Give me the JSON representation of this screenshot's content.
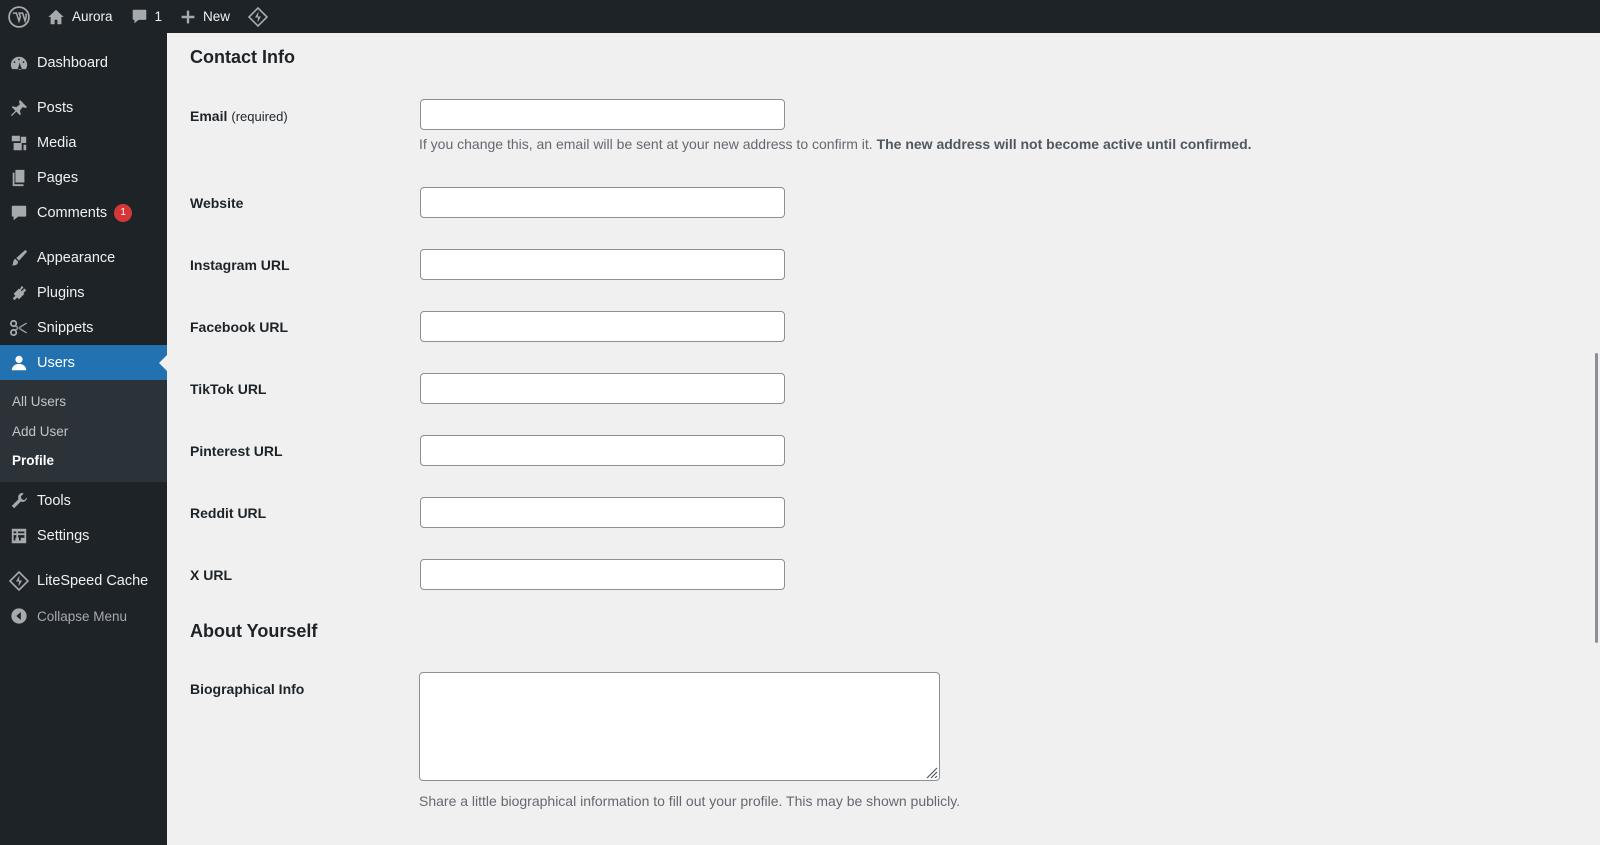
{
  "admin_bar": {
    "site_name": "Aurora",
    "comments_count": "1",
    "new_label": "New"
  },
  "sidebar": {
    "items": [
      {
        "label": "Dashboard",
        "icon": "dashboard-icon"
      },
      {
        "label": "Posts",
        "icon": "pin-icon"
      },
      {
        "label": "Media",
        "icon": "media-icon"
      },
      {
        "label": "Pages",
        "icon": "pages-icon"
      },
      {
        "label": "Comments",
        "icon": "comment-icon",
        "badge": "1"
      },
      {
        "label": "Appearance",
        "icon": "brush-icon"
      },
      {
        "label": "Plugins",
        "icon": "plugin-icon"
      },
      {
        "label": "Snippets",
        "icon": "scissors-icon"
      },
      {
        "label": "Users",
        "icon": "user-icon",
        "current": true
      },
      {
        "label": "Tools",
        "icon": "wrench-icon"
      },
      {
        "label": "Settings",
        "icon": "settings-icon"
      },
      {
        "label": "LiteSpeed Cache",
        "icon": "litespeed-icon"
      },
      {
        "label": "Collapse Menu",
        "icon": "collapse-icon"
      }
    ],
    "users_submenu": [
      {
        "label": "All Users"
      },
      {
        "label": "Add User"
      },
      {
        "label": "Profile",
        "active": true
      }
    ]
  },
  "contact_info": {
    "title": "Contact Info",
    "email": {
      "label": "Email",
      "required": "(required)",
      "value": "",
      "description_normal": "If you change this, an email will be sent at your new address to confirm it.",
      "description_bold": "The new address will not become active until confirmed."
    },
    "fields": [
      {
        "label": "Website",
        "value": ""
      },
      {
        "label": "Instagram URL",
        "value": ""
      },
      {
        "label": "Facebook URL",
        "value": ""
      },
      {
        "label": "TikTok URL",
        "value": ""
      },
      {
        "label": "Pinterest URL",
        "value": ""
      },
      {
        "label": "Reddit URL",
        "value": ""
      },
      {
        "label": "X URL",
        "value": ""
      }
    ]
  },
  "about": {
    "title": "About Yourself",
    "bio_label": "Biographical Info",
    "bio_value": "",
    "bio_description": "Share a little biographical information to fill out your profile. This may be shown publicly."
  },
  "colors": {
    "admin_bar_bg": "#1d2327",
    "accent": "#2271b1",
    "badge": "#d63638",
    "page_bg": "#f0f0f1"
  }
}
